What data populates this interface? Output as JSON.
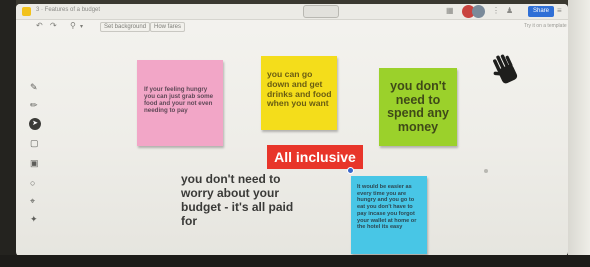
{
  "topbar": {
    "title": "3 · Features of a budget",
    "center_label": "",
    "share_label": "Share"
  },
  "toolbar": {
    "set_background": "Set background",
    "how_label": "How fares",
    "right_hint": "Try it on a template"
  },
  "notes": {
    "pink": "If your feeling hungry you can just grab some food and your not even needing to pay",
    "yellow": "you can go down and get drinks and food when you want",
    "green": "you don't need to spend any money",
    "blue": "It would be easier as every time you are hungry and you go to eat you don't have to pay incase you forgot your wallet at home or the hotel its easy"
  },
  "label": "All inclusive",
  "big_text": "you don't need to worry about your budget - it's all paid for",
  "icons": {
    "hand": "hand-icon",
    "rail": [
      "pen-icon",
      "marker-icon",
      "select-icon",
      "note-icon",
      "image-icon",
      "shape-icon",
      "crop-icon",
      "more-icon"
    ]
  },
  "colors": {
    "pink": "#f2a6c7",
    "yellow": "#f4dd1b",
    "green": "#9bd12b",
    "blue": "#48c6e6",
    "red": "#e8352a",
    "accent": "#2f6fd6"
  }
}
